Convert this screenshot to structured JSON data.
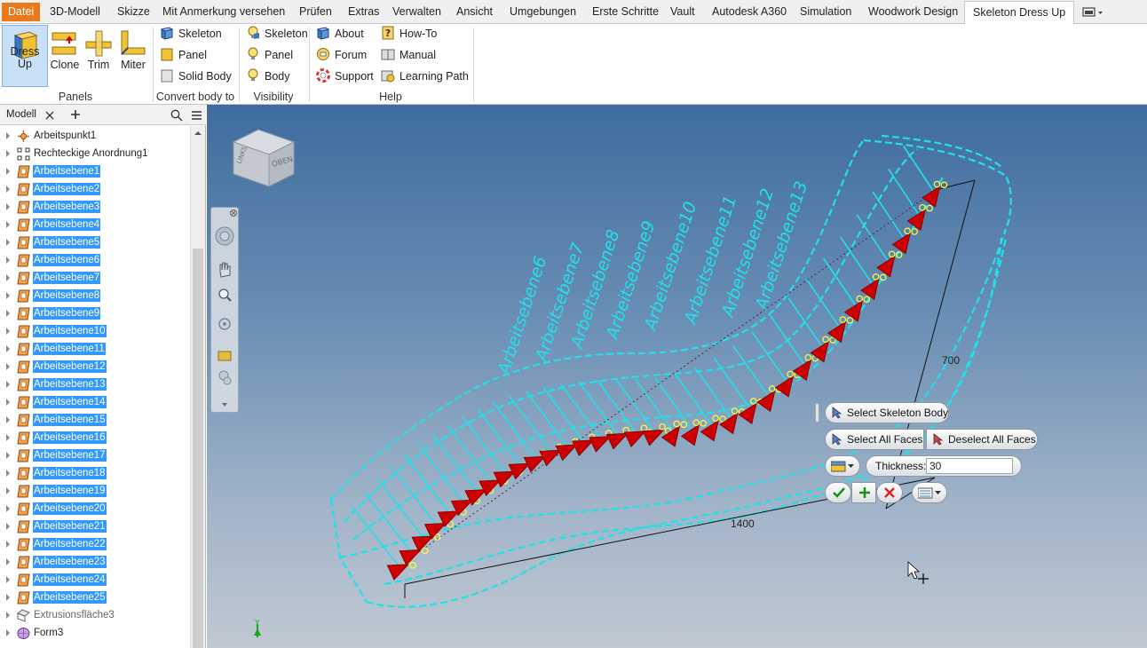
{
  "menu": {
    "tabs": [
      "Datei",
      "3D-Modell",
      "Skizze",
      "Mit Anmerkung versehen",
      "Prüfen",
      "Extras",
      "Verwalten",
      "Ansicht",
      "Umgebungen",
      "Erste Schritte",
      "Vault",
      "Autodesk A360",
      "Simulation",
      "Woodwork Design",
      "Skeleton Dress Up"
    ],
    "active": "Skeleton Dress Up"
  },
  "ribbon": {
    "panels_group": {
      "label": "Panels",
      "buttons": [
        "Dress Up",
        "Clone",
        "Trim",
        "Miter"
      ]
    },
    "convert_group": {
      "label": "Convert body to",
      "buttons": [
        "Skeleton",
        "Panel",
        "Solid Body"
      ]
    },
    "visibility_group": {
      "label": "Visibility",
      "buttons": [
        "Skeleton",
        "Panel",
        "Body"
      ]
    },
    "help_group": {
      "label": "Help",
      "buttons": [
        "About",
        "Forum",
        "Support",
        "How-To",
        "Manual",
        "Learning Path"
      ]
    }
  },
  "browser": {
    "title": "Modell",
    "items": [
      {
        "label": "Arbeitspunkt1",
        "type": "point",
        "selected": false
      },
      {
        "label": "Rechteckige Anordnung1",
        "type": "pattern",
        "selected": false
      },
      {
        "label": "Arbeitsebene1",
        "type": "plane",
        "selected": true
      },
      {
        "label": "Arbeitsebene2",
        "type": "plane",
        "selected": true
      },
      {
        "label": "Arbeitsebene3",
        "type": "plane",
        "selected": true
      },
      {
        "label": "Arbeitsebene4",
        "type": "plane",
        "selected": true
      },
      {
        "label": "Arbeitsebene5",
        "type": "plane",
        "selected": true
      },
      {
        "label": "Arbeitsebene6",
        "type": "plane",
        "selected": true
      },
      {
        "label": "Arbeitsebene7",
        "type": "plane",
        "selected": true
      },
      {
        "label": "Arbeitsebene8",
        "type": "plane",
        "selected": true
      },
      {
        "label": "Arbeitsebene9",
        "type": "plane",
        "selected": true
      },
      {
        "label": "Arbeitsebene10",
        "type": "plane",
        "selected": true
      },
      {
        "label": "Arbeitsebene11",
        "type": "plane",
        "selected": true
      },
      {
        "label": "Arbeitsebene12",
        "type": "plane",
        "selected": true
      },
      {
        "label": "Arbeitsebene13",
        "type": "plane",
        "selected": true
      },
      {
        "label": "Arbeitsebene14",
        "type": "plane",
        "selected": true
      },
      {
        "label": "Arbeitsebene15",
        "type": "plane",
        "selected": true
      },
      {
        "label": "Arbeitsebene16",
        "type": "plane",
        "selected": true
      },
      {
        "label": "Arbeitsebene17",
        "type": "plane",
        "selected": true
      },
      {
        "label": "Arbeitsebene18",
        "type": "plane",
        "selected": true
      },
      {
        "label": "Arbeitsebene19",
        "type": "plane",
        "selected": true
      },
      {
        "label": "Arbeitsebene20",
        "type": "plane",
        "selected": true
      },
      {
        "label": "Arbeitsebene21",
        "type": "plane",
        "selected": true
      },
      {
        "label": "Arbeitsebene22",
        "type": "plane",
        "selected": true
      },
      {
        "label": "Arbeitsebene23",
        "type": "plane",
        "selected": true
      },
      {
        "label": "Arbeitsebene24",
        "type": "plane",
        "selected": true
      },
      {
        "label": "Arbeitsebene25",
        "type": "plane",
        "selected": true
      },
      {
        "label": "Extrusionsfläche3",
        "type": "surface",
        "selected": false
      },
      {
        "label": "Form3",
        "type": "form",
        "selected": false
      }
    ]
  },
  "viewport": {
    "viewcube_label": "OBEN",
    "viewcube_side": "LINKS",
    "dimension_height": "700",
    "dimension_length": "1400",
    "plane_labels": [
      "Arbeitsebene6",
      "Arbeitsebene7",
      "Arbeitsebene8",
      "Arbeitsebene9",
      "Arbeitsebene10",
      "Arbeitsebene11",
      "Arbeitsebene12",
      "Arbeitsebene13"
    ],
    "colors": {
      "wire": "#22e0e8",
      "arrow": "#cc0000",
      "dim_line": "#111111"
    }
  },
  "minitoolbar": {
    "select_skeleton": "Select Skeleton Body",
    "select_all": "Select All Faces",
    "deselect_all": "Deselect All Faces",
    "thickness_label": "Thickness:",
    "thickness_value": "30"
  }
}
